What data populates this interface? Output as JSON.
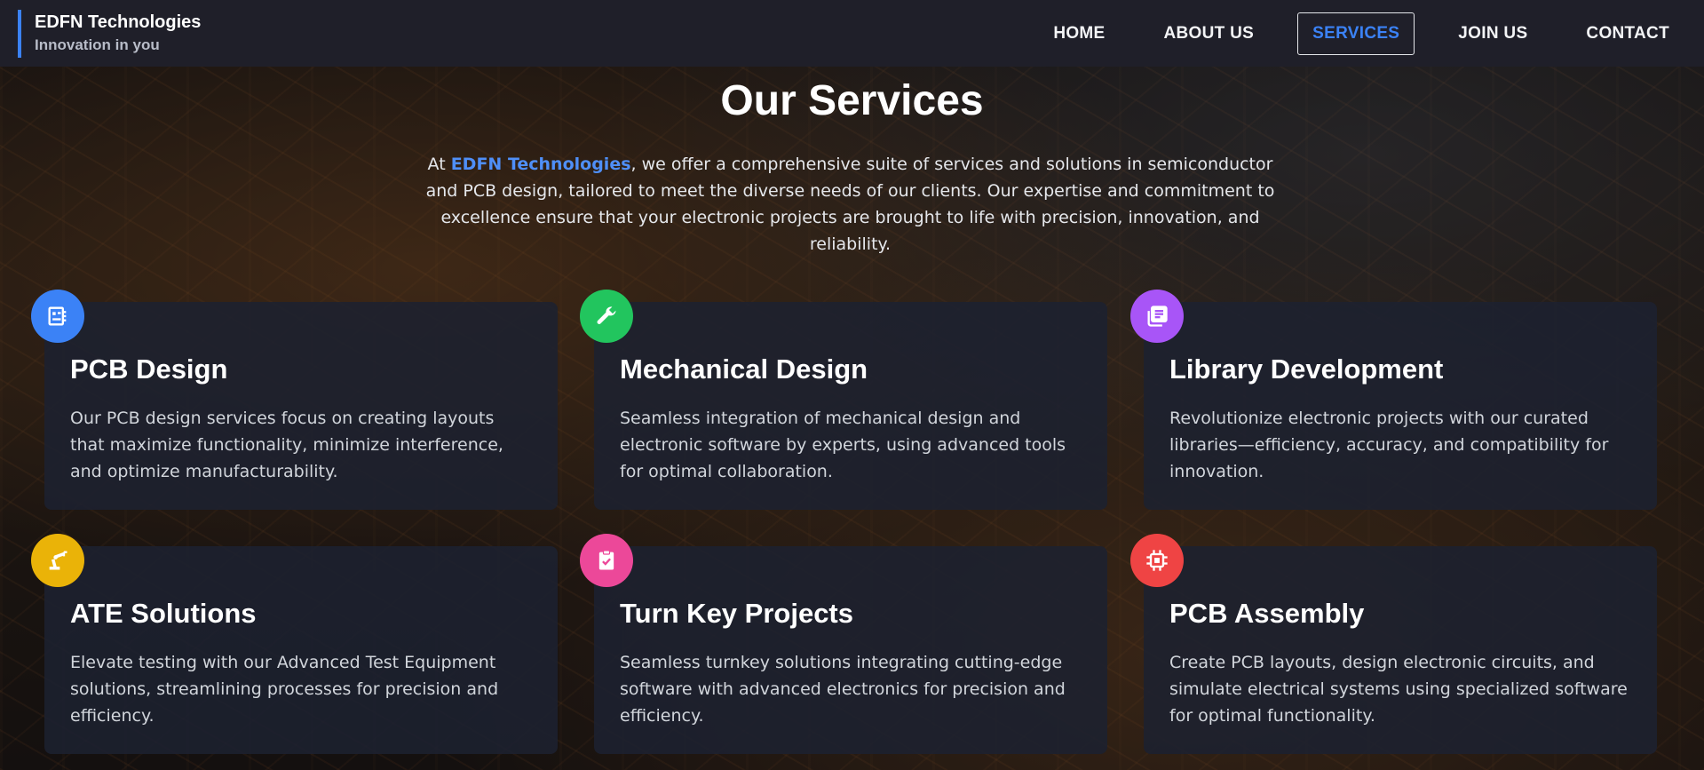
{
  "header": {
    "brand_name": "EDFN Technologies",
    "brand_tagline": "Innovation in you",
    "nav": [
      {
        "label": "HOME",
        "active": false
      },
      {
        "label": "ABOUT US",
        "active": false
      },
      {
        "label": "SERVICES",
        "active": true
      },
      {
        "label": "JOIN US",
        "active": false
      },
      {
        "label": "CONTACT",
        "active": false
      }
    ]
  },
  "main": {
    "title": "Our Services",
    "intro_prefix": "At ",
    "intro_highlight": "EDFN Technologies",
    "intro_rest": ", we offer a comprehensive suite of services and solutions in semiconductor and PCB design, tailored to meet the diverse needs of our clients. Our expertise and commitment to excellence ensure that your electronic projects are brought to life with precision, innovation, and reliability.",
    "services": [
      {
        "title": "PCB Design",
        "description": "Our PCB design services focus on creating layouts that maximize functionality, minimize interference, and optimize manufacturability.",
        "icon": "circuit-board-icon",
        "color": "#3b82f6"
      },
      {
        "title": "Mechanical Design",
        "description": "Seamless integration of mechanical design and electronic software by experts, using advanced tools for optimal collaboration.",
        "icon": "wrench-icon",
        "color": "#22c55e"
      },
      {
        "title": "Library Development",
        "description": "Revolutionize electronic projects with our curated libraries—efficiency, accuracy, and compatibility for innovation.",
        "icon": "library-icon",
        "color": "#a855f7"
      },
      {
        "title": "ATE Solutions",
        "description": "Elevate testing with our Advanced Test Equipment solutions, streamlining processes for precision and efficiency.",
        "icon": "robot-arm-icon",
        "color": "#eab308"
      },
      {
        "title": "Turn Key Projects",
        "description": "Seamless turnkey solutions integrating cutting-edge software with advanced electronics for precision and efficiency.",
        "icon": "clipboard-check-icon",
        "color": "#ec4899"
      },
      {
        "title": "PCB Assembly",
        "description": "Create PCB layouts, design electronic circuits, and simulate electrical systems using specialized software for optimal functionality.",
        "icon": "chip-icon",
        "color": "#ef4444"
      }
    ]
  },
  "colors": {
    "header_bg": "#1f1f29",
    "accent": "#3b82f6",
    "card_bg": "#1c2130"
  }
}
